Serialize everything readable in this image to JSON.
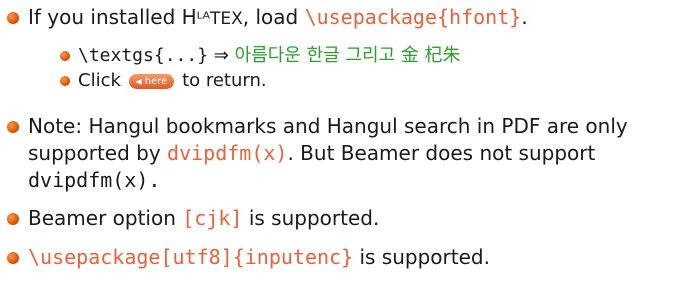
{
  "items": [
    {
      "prefix": "If you installed H",
      "latex_text": "ᴸᴬTEX",
      "mid": ", load ",
      "code": "\\usepackage{hfont}",
      "suffix": "."
    },
    {
      "text": "Note: Hangul bookmarks and Hangul search in PDF are only supported by ",
      "code": "dvipdfm(x)",
      "text2": ". But Beamer does not support ",
      "code2": "dvipdfm(x).",
      "line1": "Note: Hangul bookmarks and Hangul search in PDF are only",
      "line2a": "supported by ",
      "line2b": ". But Beamer does not support",
      "line3": "dvipdfm(x)."
    },
    {
      "text": "Beamer option ",
      "code": "[cjk]",
      "suffix": " is supported."
    },
    {
      "code": "\\usepackage[utf8]{inputenc}",
      "suffix": " is supported."
    }
  ],
  "subitems": [
    {
      "code": "\\textgs{...}",
      "arrow": "⇒",
      "korean": "아름다운 한글 그리고 金 杞朱"
    },
    {
      "text_before": "Click",
      "button_label": "here",
      "text_after": "to return."
    }
  ],
  "colors": {
    "accent": "#e8623e",
    "green": "#2e9e2e",
    "bullet": "#e35a05"
  },
  "icons": {
    "bullet": "orange-ball-bullet",
    "button_arrow": "left-triangle-icon"
  }
}
